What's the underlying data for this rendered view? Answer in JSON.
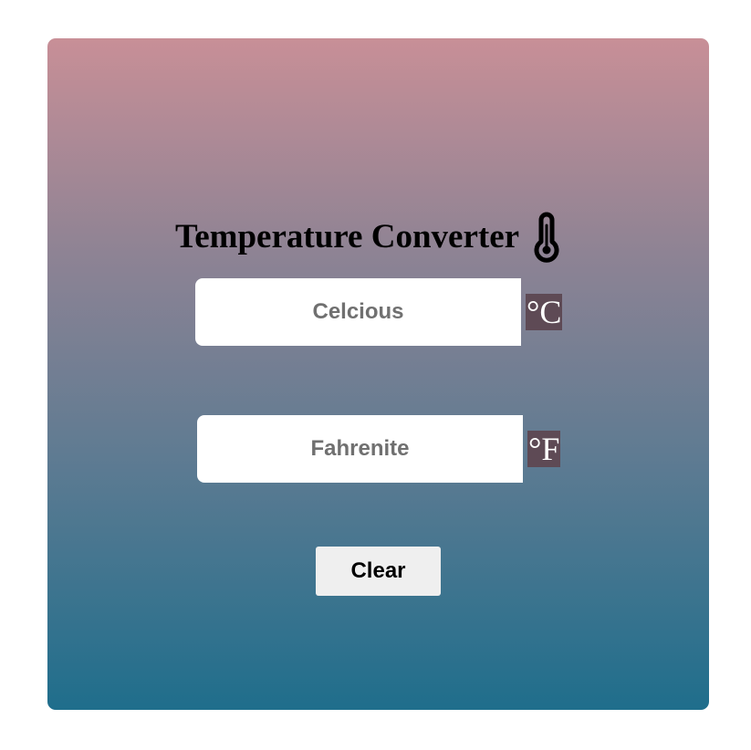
{
  "header": {
    "title": "Temperature Converter",
    "title_icon": "thermometer-icon"
  },
  "celsius": {
    "placeholder": "Celcious",
    "value": "",
    "unit_label": "°C"
  },
  "fahrenheit": {
    "placeholder": "Fahrenite",
    "value": "",
    "unit_label": "°F"
  },
  "actions": {
    "clear_label": "Clear"
  },
  "colors": {
    "gradient_top": "#c88f97",
    "gradient_bottom": "#1f6e8c",
    "unit_badge": "#5e4a55",
    "button_bg": "#efefef"
  }
}
